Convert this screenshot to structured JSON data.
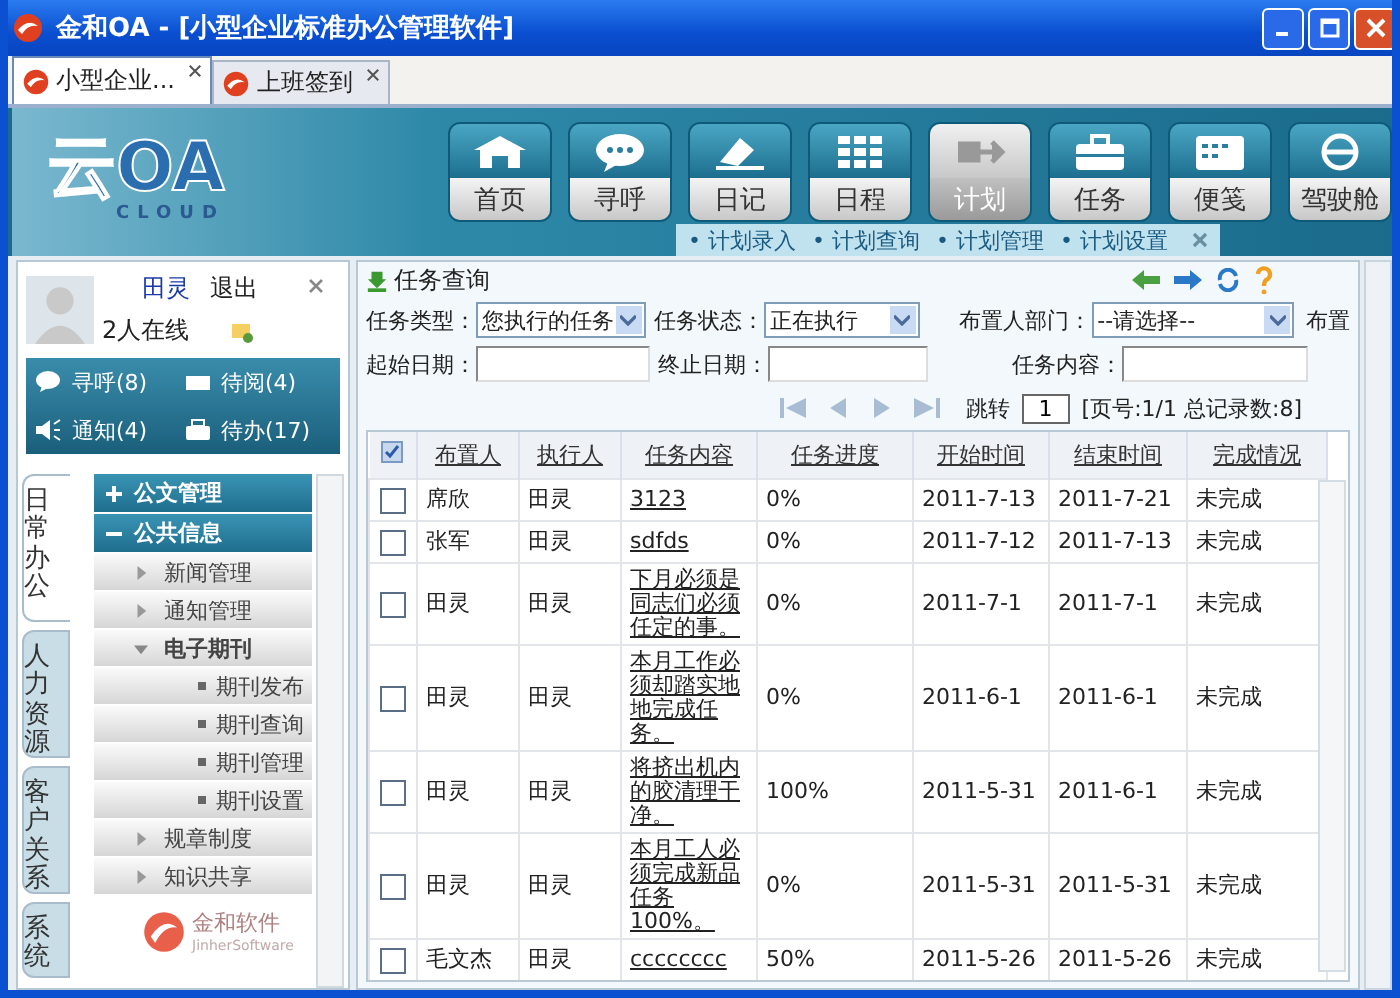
{
  "window": {
    "title": "金和OA - [小型企业标准办公管理软件]"
  },
  "doc_tabs": [
    {
      "label": "小型企业...",
      "selected": true
    },
    {
      "label": "上班签到",
      "selected": false
    }
  ],
  "logo": {
    "text": "云OA",
    "subtext": "CLOUD"
  },
  "nav": [
    {
      "label": "首页",
      "kind": "home",
      "selected": false
    },
    {
      "label": "寻呼",
      "kind": "chat",
      "selected": false
    },
    {
      "label": "日记",
      "kind": "diary",
      "selected": false
    },
    {
      "label": "日程",
      "kind": "calendar",
      "selected": false
    },
    {
      "label": "计划",
      "kind": "plan",
      "selected": true
    },
    {
      "label": "任务",
      "kind": "task",
      "selected": false
    },
    {
      "label": "便笺",
      "kind": "note",
      "selected": false
    },
    {
      "label": "驾驶舱",
      "kind": "cockpit",
      "selected": false
    }
  ],
  "submenu": [
    "• 计划录入",
    "• 计划查询",
    "• 计划管理",
    "• 计划设置"
  ],
  "user": {
    "name": "田灵",
    "logout": "退出",
    "online": "2人在线"
  },
  "stats": [
    {
      "label": "寻呼(8)",
      "kind": "chat"
    },
    {
      "label": "待阅(4)",
      "kind": "mail"
    },
    {
      "label": "通知(4)",
      "kind": "speaker"
    },
    {
      "label": "待办(17)",
      "kind": "case"
    }
  ],
  "side_tabs": [
    {
      "label": "日常办公",
      "selected": true
    },
    {
      "label": "人力资源",
      "selected": false
    },
    {
      "label": "客户关系",
      "selected": false
    },
    {
      "label": "系统",
      "selected": false
    }
  ],
  "tree": [
    {
      "label": "公文管理",
      "expanded": false
    },
    {
      "label": "公共信息",
      "expanded": true,
      "children": [
        {
          "label": "新闻管理",
          "expanded": false
        },
        {
          "label": "通知管理",
          "expanded": false
        },
        {
          "label": "电子期刊",
          "expanded": true,
          "children": [
            {
              "label": "期刊发布"
            },
            {
              "label": "期刊查询"
            },
            {
              "label": "期刊管理"
            },
            {
              "label": "期刊设置"
            }
          ]
        },
        {
          "label": "规章制度",
          "expanded": false
        },
        {
          "label": "知识共享",
          "expanded": false
        }
      ]
    }
  ],
  "brand": {
    "name": "金和软件",
    "tagline": "JinherSoftware"
  },
  "query": {
    "title": "任务查询",
    "rows": [
      [
        {
          "label": "任务类型：",
          "kind": "select",
          "value": "您执行的任务"
        },
        {
          "label": "任务状态：",
          "kind": "select",
          "value": "正在执行"
        },
        {
          "label": "布置人部门：",
          "kind": "select",
          "value": "--请选择--"
        },
        {
          "label": "布置",
          "kind": "label"
        }
      ],
      [
        {
          "label": "起始日期：",
          "kind": "input"
        },
        {
          "label": "终止日期：",
          "kind": "input"
        },
        {
          "label": "任务内容：",
          "kind": "input"
        }
      ]
    ]
  },
  "pager": {
    "jump": "跳转",
    "page": "1",
    "info": "[页号:1/1 总记录数:8]"
  },
  "table": {
    "columns": [
      "布置人",
      "执行人",
      "任务内容",
      "任务进度",
      "开始时间",
      "结束时间",
      "完成情况"
    ],
    "rows": [
      {
        "checked": false,
        "cells": [
          "席欣",
          "田灵",
          "3123",
          "0%",
          "2011-7-13",
          "2011-7-21",
          "未完成"
        ]
      },
      {
        "checked": false,
        "cells": [
          "张军",
          "田灵",
          "sdfds",
          "0%",
          "2011-7-12",
          "2011-7-13",
          "未完成"
        ]
      },
      {
        "checked": false,
        "cells": [
          "田灵",
          "田灵",
          "下月必须是同志们必须任定的事。",
          "0%",
          "2011-7-1",
          "2011-7-1",
          "未完成"
        ]
      },
      {
        "checked": false,
        "cells": [
          "田灵",
          "田灵",
          "本月工作必须却踏实地地完成任务。",
          "0%",
          "2011-6-1",
          "2011-6-1",
          "未完成"
        ]
      },
      {
        "checked": false,
        "cells": [
          "田灵",
          "田灵",
          "将挤出机内的胶清理干净。",
          "100%",
          "2011-5-31",
          "2011-6-1",
          "未完成"
        ]
      },
      {
        "checked": false,
        "cells": [
          "田灵",
          "田灵",
          "本月工人必须完成新品任务100%。",
          "0%",
          "2011-5-31",
          "2011-5-31",
          "未完成"
        ]
      },
      {
        "checked": false,
        "cells": [
          "毛文杰",
          "田灵",
          "cccccccc",
          "50%",
          "2011-5-26",
          "2011-5-26",
          "未完成"
        ]
      }
    ]
  }
}
